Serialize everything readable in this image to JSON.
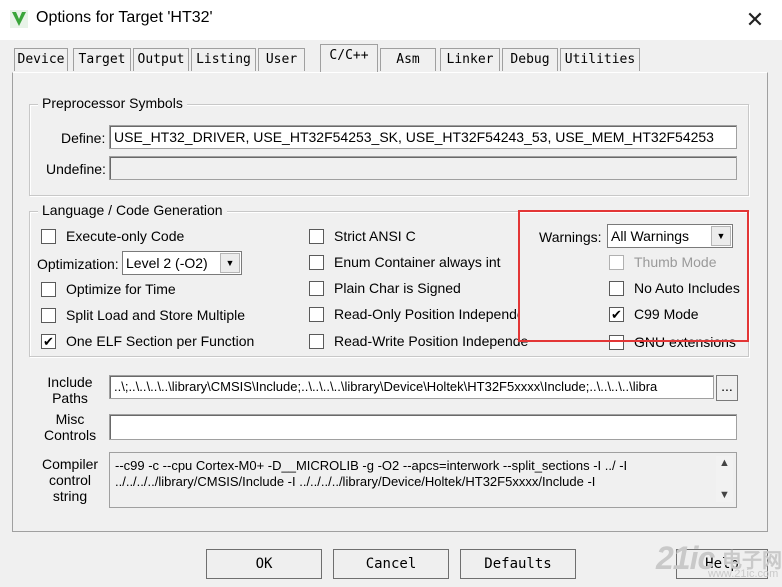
{
  "window": {
    "title": "Options for Target 'HT32'",
    "close": "✕"
  },
  "tabs": [
    {
      "label": "Device"
    },
    {
      "label": "Target"
    },
    {
      "label": "Output"
    },
    {
      "label": "Listing"
    },
    {
      "label": "User"
    },
    {
      "label": "C/C++"
    },
    {
      "label": "Asm"
    },
    {
      "label": "Linker"
    },
    {
      "label": "Debug"
    },
    {
      "label": "Utilities"
    }
  ],
  "preprocessor": {
    "group_label": "Preprocessor Symbols",
    "define_label": "Define:",
    "define_value": "USE_HT32_DRIVER, USE_HT32F54253_SK, USE_HT32F54243_53, USE_MEM_HT32F54253",
    "undefine_label": "Undefine:",
    "undefine_value": ""
  },
  "language": {
    "group_label": "Language / Code Generation",
    "execute_only": {
      "label": "Execute-only Code",
      "checked": false
    },
    "optimization_label": "Optimization:",
    "optimization_value": "Level 2 (-O2)",
    "optimize_time": {
      "label": "Optimize for Time",
      "checked": false
    },
    "split_load": {
      "label": "Split Load and Store Multiple",
      "checked": false
    },
    "one_elf": {
      "label": "One ELF Section per Function",
      "checked": true
    },
    "strict_ansi": {
      "label": "Strict ANSI C",
      "checked": false
    },
    "enum_int": {
      "label": "Enum Container always int",
      "checked": false
    },
    "plain_char": {
      "label": "Plain Char is Signed",
      "checked": false
    },
    "ro_pi": {
      "label": "Read-Only Position Independent",
      "checked": false
    },
    "rw_pi": {
      "label": "Read-Write Position Independent",
      "checked": false
    },
    "warnings_label": "Warnings:",
    "warnings_value": "All Warnings",
    "thumb_mode": {
      "label": "Thumb Mode",
      "checked": false,
      "disabled": true
    },
    "no_auto_includes": {
      "label": "No Auto Includes",
      "checked": false
    },
    "c99_mode": {
      "label": "C99 Mode",
      "checked": true
    },
    "gnu_extensions": {
      "label": "GNU extensions",
      "checked": false
    }
  },
  "include_paths": {
    "label": "Include Paths",
    "value": "..\\;..\\..\\..\\..\\library\\CMSIS\\Include;..\\..\\..\\..\\library\\Device\\Holtek\\HT32F5xxxx\\Include;..\\..\\..\\..\\libra",
    "browse": "..."
  },
  "misc_controls": {
    "label": "Misc Controls",
    "value": ""
  },
  "compiler_control": {
    "label": "Compiler control string",
    "line1": "--c99 -c --cpu Cortex-M0+ -D__MICROLIB -g -O2 --apcs=interwork --split_sections -I ../ -I",
    "line2": "../../../../library/CMSIS/Include -I ../../../../library/Device/Holtek/HT32F5xxxx/Include -I"
  },
  "buttons": {
    "ok": "OK",
    "cancel": "Cancel",
    "defaults": "Defaults",
    "help": "Help"
  },
  "watermark": {
    "big": "21ic",
    "cn": "电子网",
    "small": "www.21ic.com"
  },
  "colors": {
    "highlight": "#e33636",
    "app_icon": "#3aa53a"
  }
}
